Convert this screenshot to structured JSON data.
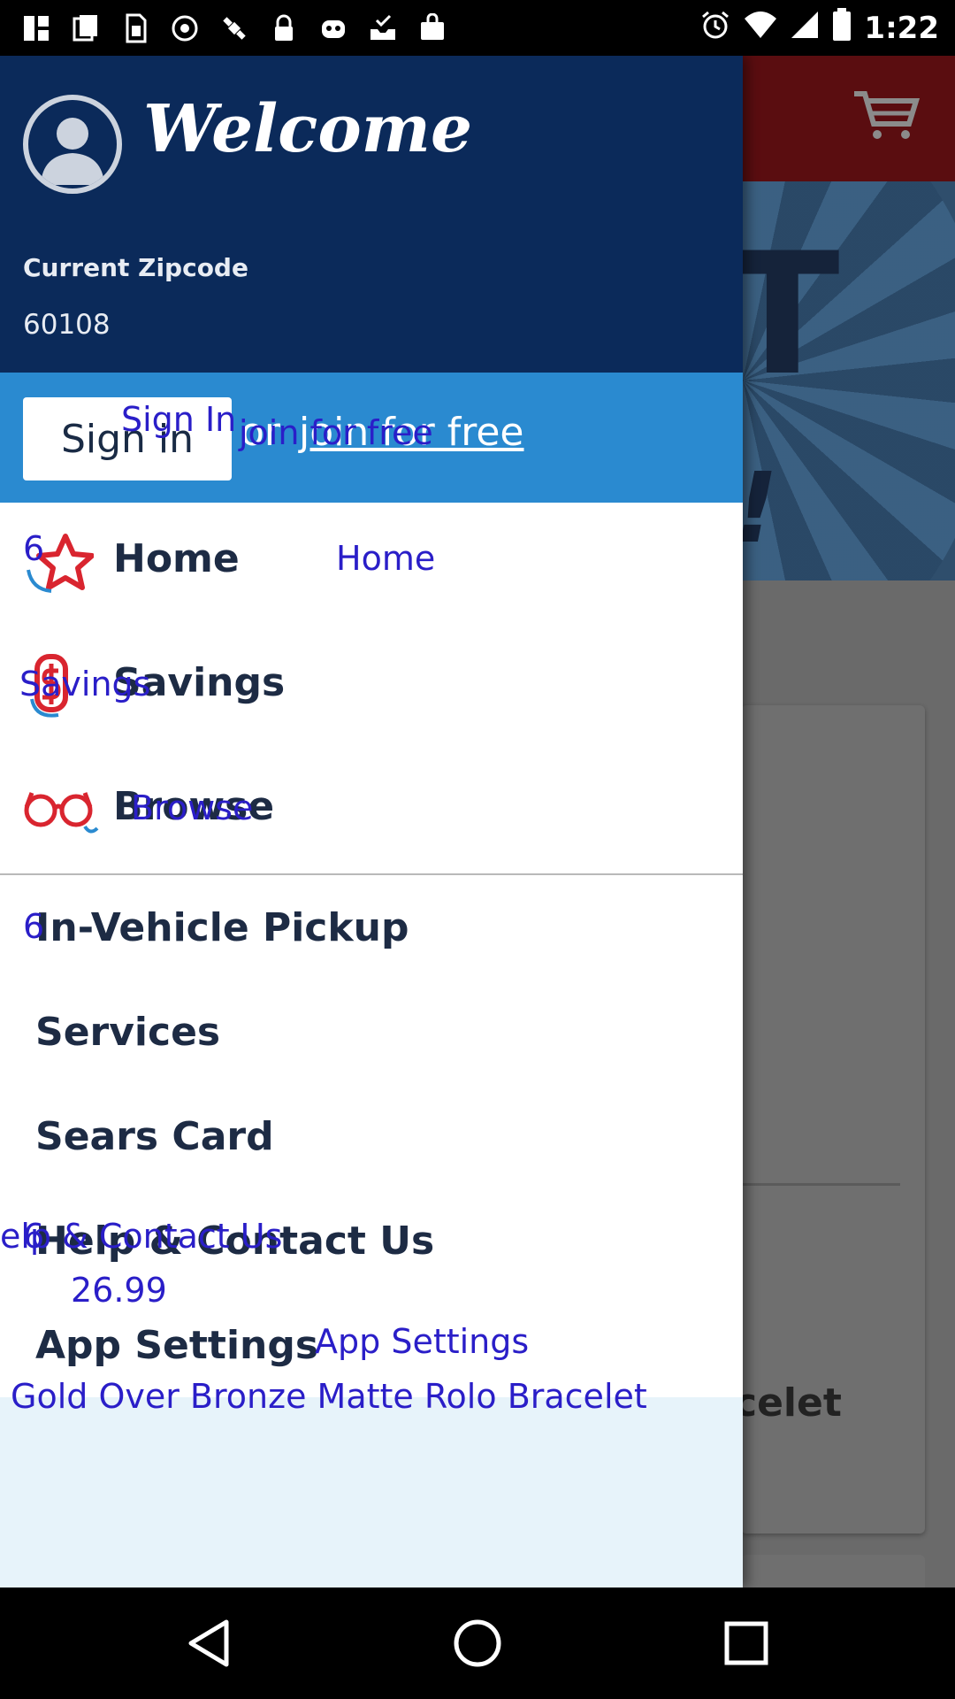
{
  "status_bar": {
    "time": "1:22",
    "left_icons": [
      "app-icon",
      "cards-icon",
      "sim-icon",
      "block-icon",
      "satellite-icon",
      "lock-icon",
      "bot-icon",
      "inbox-check-icon",
      "shopping-bag-icon"
    ],
    "right_icons": [
      "alarm-icon",
      "wifi-icon",
      "signal-icon",
      "battery-icon"
    ]
  },
  "drawer": {
    "welcome": "Welcome",
    "zip_label": "Current Zipcode",
    "zip_value": "60108",
    "signin_label": "Sign in",
    "or_text": "or",
    "join_label": "join for free",
    "nav_items": [
      {
        "label": "Home",
        "icon": "star-icon"
      },
      {
        "label": "Savings",
        "icon": "dollar-tag-icon"
      },
      {
        "label": "Browse",
        "icon": "glasses-icon"
      }
    ],
    "secondary_items": [
      {
        "label": "In-Vehicle Pickup"
      },
      {
        "label": "Services"
      },
      {
        "label": "Sears Card"
      },
      {
        "label": "Help & Contact Us"
      },
      {
        "label": "App Settings"
      }
    ]
  },
  "background": {
    "product_fragment": "celet"
  },
  "overlay_text": {
    "signin": "Sign In",
    "join": "join for free",
    "home_num": "6",
    "home": "Home",
    "savings": "Savings",
    "browse": "Browse",
    "pickup_num": "6",
    "help": "elp & Contact Us",
    "help_num": "6",
    "price": "26.99",
    "app_settings": "App Settings",
    "product": "Gold Over Bronze Matte Rolo Bracelet"
  },
  "colors": {
    "drawer_header": "#0b2a5a",
    "signin_band": "#2a8ad0",
    "star_red": "#d9252f",
    "icon_blue": "#2a8ad0",
    "overlay_blue": "#2a1ec8"
  }
}
